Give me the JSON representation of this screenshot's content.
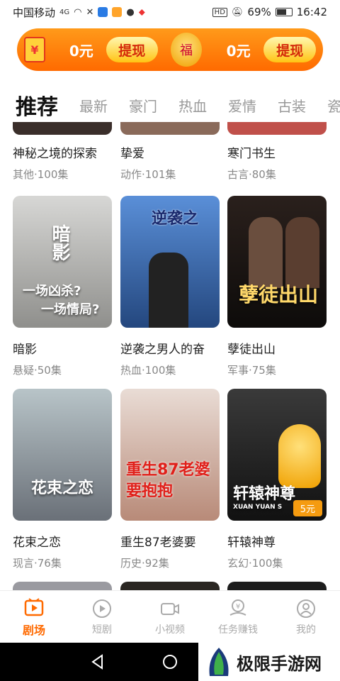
{
  "status": {
    "carrier": "中国移动",
    "net": "4G",
    "battery": "69%",
    "battery_level": 0.69,
    "time": "16:42",
    "hd": "HD"
  },
  "banner": {
    "amount_left": "0元",
    "withdraw_left": "提现",
    "amount_right": "0元",
    "withdraw_right": "提现"
  },
  "tabs": [
    "推荐",
    "最新",
    "豪门",
    "热血",
    "爱情",
    "古装",
    "瓷"
  ],
  "rows": [
    [
      {
        "title": "神秘之境的探索",
        "meta": "其他·100集"
      },
      {
        "title": "挚爱",
        "meta": "动作·101集"
      },
      {
        "title": "寒门书生",
        "meta": "古言·80集"
      }
    ],
    [
      {
        "title": "暗影",
        "meta": "悬疑·50集",
        "art": "暗影"
      },
      {
        "title": "逆袭之男人的奋",
        "meta": "热血·100集",
        "art": "逆袭之"
      },
      {
        "title": "孽徒出山",
        "meta": "军事·75集",
        "art": "孽徒出山"
      }
    ],
    [
      {
        "title": "花束之恋",
        "meta": "现言·76集",
        "art": "花束之恋"
      },
      {
        "title": "重生87老婆要",
        "meta": "历史·92集",
        "art": "重生87老婆要抱抱"
      },
      {
        "title": "轩辕神尊",
        "meta": "玄幻·100集",
        "art": "轩辕神尊",
        "price": "5元"
      }
    ]
  ],
  "poster_art_extra": {
    "shadow_tagline_1": "一场凶杀?",
    "shadow_tagline_2": "一场情局?",
    "xuan_sub": "XUAN YUAN S"
  },
  "nav": [
    {
      "label": "剧场",
      "icon": "theater-icon"
    },
    {
      "label": "短剧",
      "icon": "play-icon"
    },
    {
      "label": "小视频",
      "icon": "video-camera-icon"
    },
    {
      "label": "任务赚钱",
      "icon": "money-task-icon"
    },
    {
      "label": "我的",
      "icon": "profile-icon"
    }
  ],
  "watermark": "极限手游网",
  "colors": {
    "accent": "#ff6a00",
    "banner": "#ff8a10"
  }
}
